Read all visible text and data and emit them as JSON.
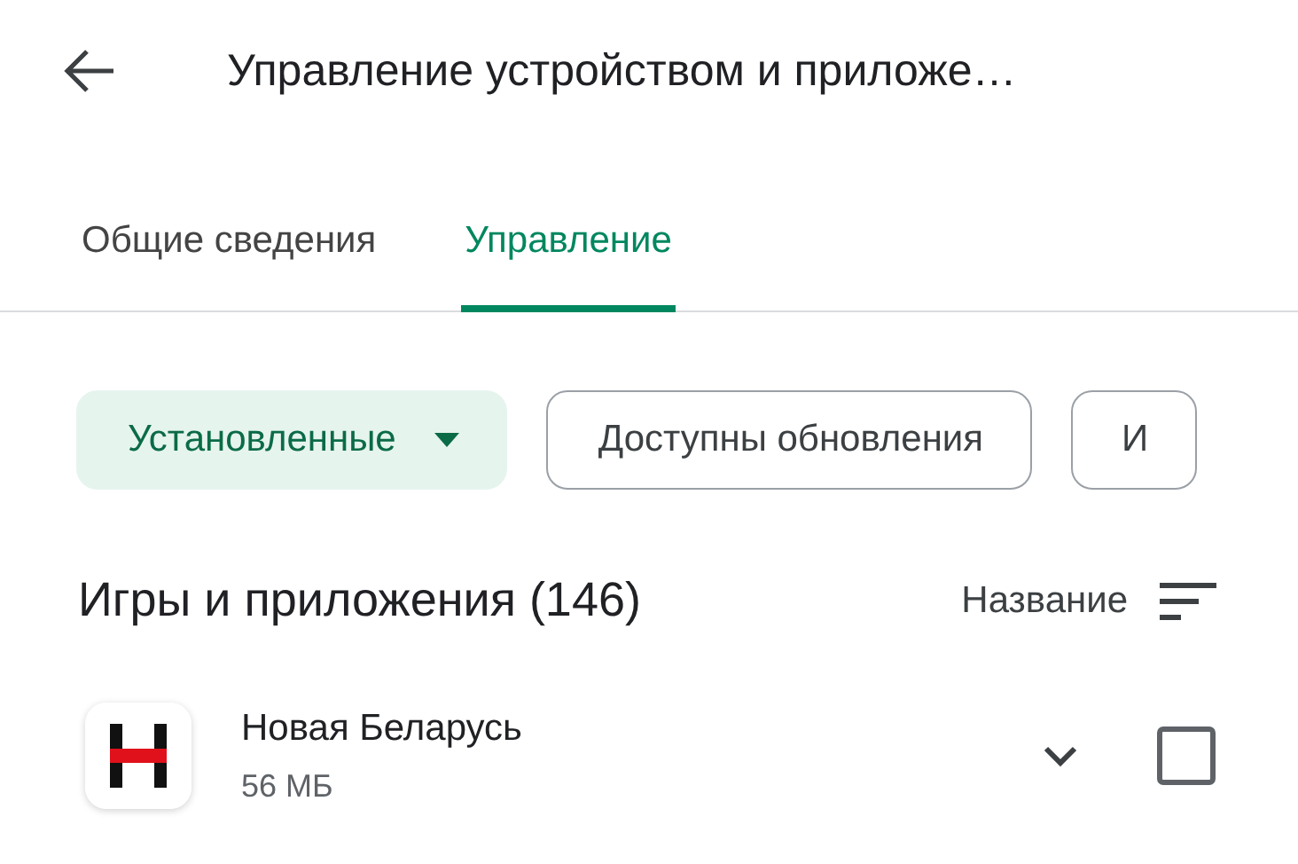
{
  "header": {
    "title": "Управление устройством и приложе…"
  },
  "tabs": [
    {
      "label": "Общие сведения",
      "selected": false
    },
    {
      "label": "Управление",
      "selected": true
    }
  ],
  "filters": [
    {
      "label": "Установленные",
      "selected": true,
      "dropdown": true
    },
    {
      "label": "Доступны обновления",
      "selected": false,
      "dropdown": false
    },
    {
      "label": "И",
      "selected": false,
      "dropdown": false
    }
  ],
  "section": {
    "title": "Игры и приложения (146)",
    "sort_label": "Название"
  },
  "apps": [
    {
      "name": "Новая Беларусь",
      "size": "56 МБ",
      "checked": false
    }
  ]
}
